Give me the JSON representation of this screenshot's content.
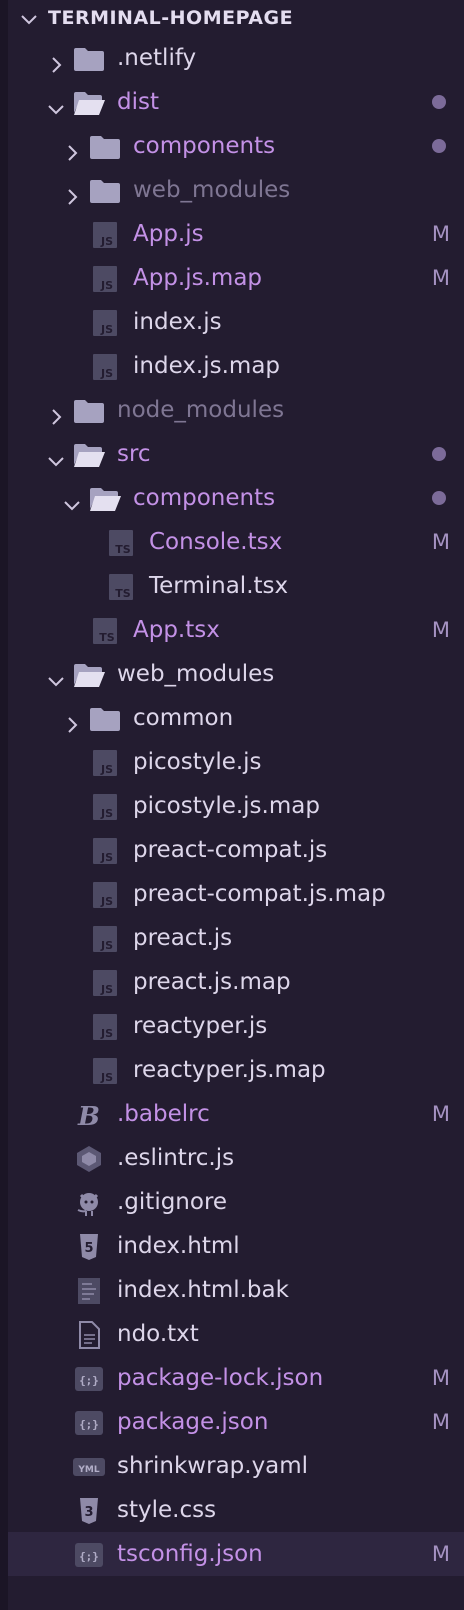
{
  "explorer": {
    "title": "TERMINAL-HOMEPAGE",
    "colors": {
      "background": "#231c30",
      "text": "#ddd6ea",
      "modified": "#c391e6",
      "ignored": "#7f7693",
      "badge": "#a592c2",
      "selected": "#2e2640"
    },
    "items": [
      {
        "label": ".netlify",
        "kind": "folder",
        "depth": 0,
        "expanded": false,
        "state": "normal",
        "badge": "",
        "dot": false,
        "icon": "folder-icon"
      },
      {
        "label": "dist",
        "kind": "folder",
        "depth": 0,
        "expanded": true,
        "state": "mod",
        "badge": "",
        "dot": true,
        "icon": "folder-open-icon"
      },
      {
        "label": "components",
        "kind": "folder",
        "depth": 1,
        "expanded": false,
        "state": "mod",
        "badge": "",
        "dot": true,
        "icon": "folder-icon"
      },
      {
        "label": "web_modules",
        "kind": "folder",
        "depth": 1,
        "expanded": false,
        "state": "dim",
        "badge": "",
        "dot": false,
        "icon": "folder-icon"
      },
      {
        "label": "App.js",
        "kind": "file",
        "depth": 1,
        "state": "mod",
        "badge": "M",
        "dot": false,
        "icon": "js-icon"
      },
      {
        "label": "App.js.map",
        "kind": "file",
        "depth": 1,
        "state": "mod",
        "badge": "M",
        "dot": false,
        "icon": "js-icon"
      },
      {
        "label": "index.js",
        "kind": "file",
        "depth": 1,
        "state": "normal",
        "badge": "",
        "dot": false,
        "icon": "js-icon"
      },
      {
        "label": "index.js.map",
        "kind": "file",
        "depth": 1,
        "state": "normal",
        "badge": "",
        "dot": false,
        "icon": "js-icon"
      },
      {
        "label": "node_modules",
        "kind": "folder",
        "depth": 0,
        "expanded": false,
        "state": "dim",
        "badge": "",
        "dot": false,
        "icon": "folder-icon"
      },
      {
        "label": "src",
        "kind": "folder",
        "depth": 0,
        "expanded": true,
        "state": "mod",
        "badge": "",
        "dot": true,
        "icon": "folder-open-icon"
      },
      {
        "label": "components",
        "kind": "folder",
        "depth": 1,
        "expanded": true,
        "state": "mod",
        "badge": "",
        "dot": true,
        "icon": "folder-open-icon"
      },
      {
        "label": "Console.tsx",
        "kind": "file",
        "depth": 2,
        "state": "mod",
        "badge": "M",
        "dot": false,
        "icon": "ts-icon"
      },
      {
        "label": "Terminal.tsx",
        "kind": "file",
        "depth": 2,
        "state": "normal",
        "badge": "",
        "dot": false,
        "icon": "ts-icon"
      },
      {
        "label": "App.tsx",
        "kind": "file",
        "depth": 1,
        "state": "mod",
        "badge": "M",
        "dot": false,
        "icon": "ts-icon"
      },
      {
        "label": "web_modules",
        "kind": "folder",
        "depth": 0,
        "expanded": true,
        "state": "normal",
        "badge": "",
        "dot": false,
        "icon": "folder-open-icon"
      },
      {
        "label": "common",
        "kind": "folder",
        "depth": 1,
        "expanded": false,
        "state": "normal",
        "badge": "",
        "dot": false,
        "icon": "folder-icon"
      },
      {
        "label": "picostyle.js",
        "kind": "file",
        "depth": 1,
        "state": "normal",
        "badge": "",
        "dot": false,
        "icon": "js-icon"
      },
      {
        "label": "picostyle.js.map",
        "kind": "file",
        "depth": 1,
        "state": "normal",
        "badge": "",
        "dot": false,
        "icon": "js-icon"
      },
      {
        "label": "preact-compat.js",
        "kind": "file",
        "depth": 1,
        "state": "normal",
        "badge": "",
        "dot": false,
        "icon": "js-icon"
      },
      {
        "label": "preact-compat.js.map",
        "kind": "file",
        "depth": 1,
        "state": "normal",
        "badge": "",
        "dot": false,
        "icon": "js-icon"
      },
      {
        "label": "preact.js",
        "kind": "file",
        "depth": 1,
        "state": "normal",
        "badge": "",
        "dot": false,
        "icon": "js-icon"
      },
      {
        "label": "preact.js.map",
        "kind": "file",
        "depth": 1,
        "state": "normal",
        "badge": "",
        "dot": false,
        "icon": "js-icon"
      },
      {
        "label": "reactyper.js",
        "kind": "file",
        "depth": 1,
        "state": "normal",
        "badge": "",
        "dot": false,
        "icon": "js-icon"
      },
      {
        "label": "reactyper.js.map",
        "kind": "file",
        "depth": 1,
        "state": "normal",
        "badge": "",
        "dot": false,
        "icon": "js-icon"
      },
      {
        "label": ".babelrc",
        "kind": "file",
        "depth": 0,
        "state": "mod",
        "badge": "M",
        "dot": false,
        "icon": "babel-icon"
      },
      {
        "label": ".eslintrc.js",
        "kind": "file",
        "depth": 0,
        "state": "normal",
        "badge": "",
        "dot": false,
        "icon": "eslint-icon"
      },
      {
        "label": ".gitignore",
        "kind": "file",
        "depth": 0,
        "state": "normal",
        "badge": "",
        "dot": false,
        "icon": "github-icon"
      },
      {
        "label": "index.html",
        "kind": "file",
        "depth": 0,
        "state": "normal",
        "badge": "",
        "dot": false,
        "icon": "html5-icon"
      },
      {
        "label": "index.html.bak",
        "kind": "file",
        "depth": 0,
        "state": "normal",
        "badge": "",
        "dot": false,
        "icon": "backup-file-icon"
      },
      {
        "label": "ndo.txt",
        "kind": "file",
        "depth": 0,
        "state": "normal",
        "badge": "",
        "dot": false,
        "icon": "text-file-icon"
      },
      {
        "label": "package-lock.json",
        "kind": "file",
        "depth": 0,
        "state": "mod",
        "badge": "M",
        "dot": false,
        "icon": "json-icon"
      },
      {
        "label": "package.json",
        "kind": "file",
        "depth": 0,
        "state": "mod",
        "badge": "M",
        "dot": false,
        "icon": "json-icon"
      },
      {
        "label": "shrinkwrap.yaml",
        "kind": "file",
        "depth": 0,
        "state": "normal",
        "badge": "",
        "dot": false,
        "icon": "yaml-icon"
      },
      {
        "label": "style.css",
        "kind": "file",
        "depth": 0,
        "state": "normal",
        "badge": "",
        "dot": false,
        "icon": "css3-icon"
      },
      {
        "label": "tsconfig.json",
        "kind": "file",
        "depth": 0,
        "state": "mod",
        "badge": "M",
        "dot": false,
        "icon": "json-icon",
        "selected": true
      }
    ]
  }
}
